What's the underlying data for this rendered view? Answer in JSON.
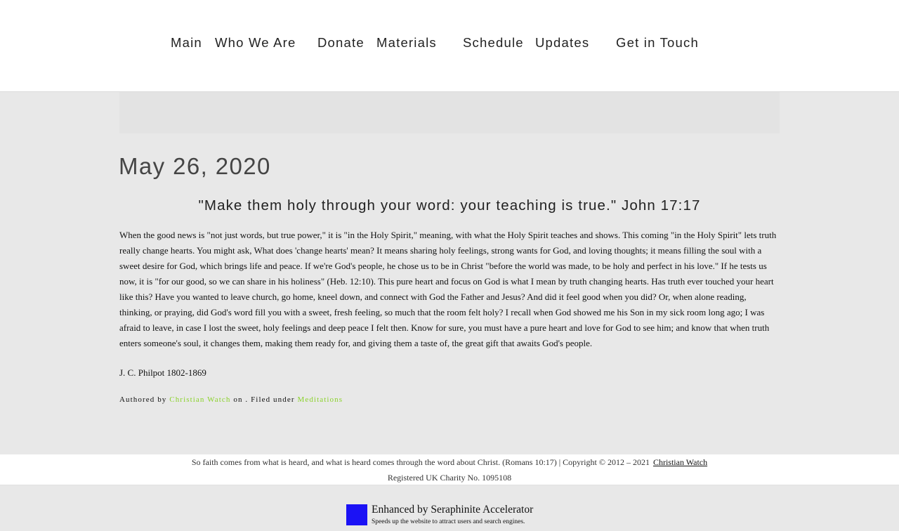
{
  "nav": {
    "items": [
      {
        "label": "Main"
      },
      {
        "label": "Who We Are"
      },
      {
        "label": "Donate"
      },
      {
        "label": "Materials"
      },
      {
        "label": "Schedule"
      },
      {
        "label": "Updates"
      },
      {
        "label": "Get in Touch"
      }
    ]
  },
  "post": {
    "date": "May 26, 2020",
    "verse": "\"Make them holy through your word: your teaching is true.\" John 17:17",
    "body": "When the good news is \"not just words, but true power,\" it is \"in the Holy Spirit,\" meaning, with what the Holy Spirit teaches and shows. This coming \"in the Holy Spirit\" lets truth really change hearts. You might ask, What does 'change hearts' mean? It means sharing holy feelings, strong wants for God, and loving thoughts; it means filling the soul with a sweet desire for God, which brings life and peace. If we're God's people, he chose us to be in Christ \"before the world was made, to be holy and perfect in his love.\" If he tests us now, it is \"for our good, so we can share in his holiness\" (Heb. 12:10). This pure heart and focus on God is what I mean by truth changing hearts. Has truth ever touched your heart like this? Have you wanted to leave church, go home, kneel down, and connect with God the Father and Jesus? And did it feel good when you did? Or, when alone reading, thinking, or praying, did God's word fill you with a sweet, fresh feeling, so much that the room felt holy? I recall when God showed me his Son in my sick room long ago; I was afraid to leave, in case I lost the sweet, holy feelings and deep peace I felt then. Know for sure, you must have a pure heart and love for God to see him; and know that when truth enters someone's soul, it changes them, making them ready for, and giving them a taste of, the great gift that awaits God's people.",
    "signature": "J. C. Philpot 1802-1869",
    "meta": {
      "authored_prefix": "Authored by",
      "author": "Christian Watch",
      "on_text": "on . Filed under",
      "category": "Meditations"
    }
  },
  "footer": {
    "line1": "So faith comes from what is heard, and what is heard comes through the word about Christ. (Romans 10:17) | Copyright © 2012 – 2021",
    "copyright_link": "Christian Watch",
    "line2": "Registered UK Charity No. 1095108"
  },
  "badge": {
    "title": "Enhanced by Seraphinite Accelerator",
    "subtitle": "Speeds up the website to attract users and search engines.",
    "color": "#1b12f5"
  },
  "colors": {
    "link_green": "#8ad22a",
    "page_bg": "#e8e8e8",
    "header_bg": "#ffffff"
  }
}
